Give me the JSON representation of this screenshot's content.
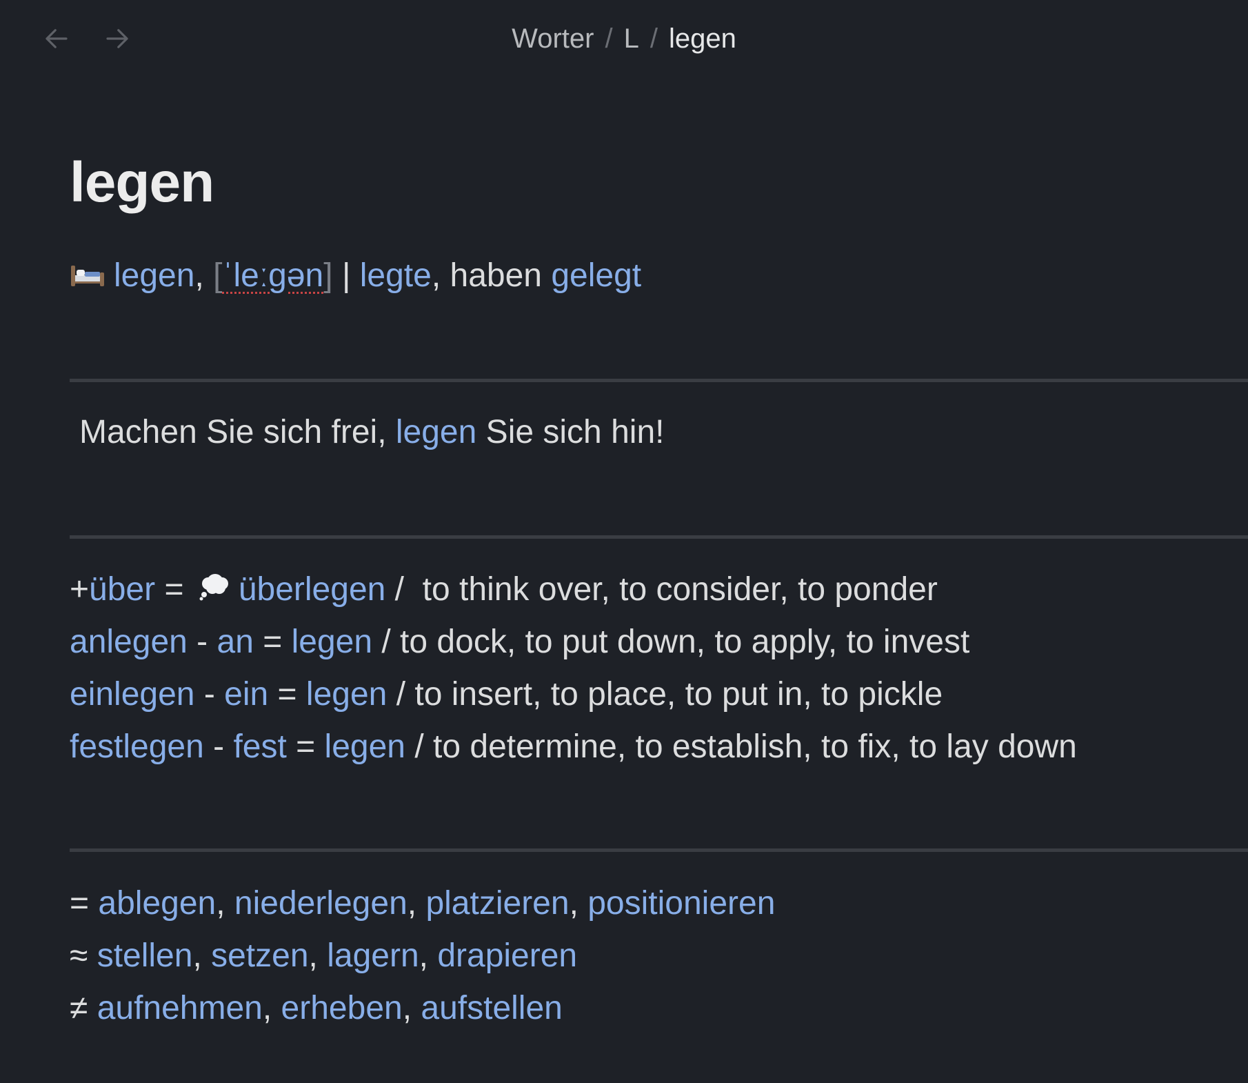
{
  "nav": {
    "back_icon": "arrow-left-icon",
    "forward_icon": "arrow-right-icon"
  },
  "breadcrumb": {
    "items": [
      "Worter",
      "L",
      "legen"
    ],
    "separator": "/"
  },
  "page": {
    "title": "legen"
  },
  "header_line": {
    "icon": "bed-icon",
    "word": "legen",
    "comma1": ",",
    "ipa_open": "[",
    "ipa": "ˈleːɡən",
    "ipa_close": "]",
    "pipe": "|",
    "preterite": "legte",
    "mid_text": ", haben",
    "participle": "gelegt"
  },
  "example": {
    "before": "Machen Sie sich frei,",
    "link": "legen",
    "after": "Sie sich hin!"
  },
  "compounds": [
    {
      "parts": [
        {
          "t": "+",
          "link": false
        },
        {
          "t": "über",
          "link": true
        },
        {
          "t": " = ",
          "link": false
        },
        {
          "icon": "thought-bubble-icon"
        },
        {
          "t": "überlegen",
          "link": true
        },
        {
          "t": " /  to think over, to consider, to ponder",
          "link": false
        }
      ]
    },
    {
      "parts": [
        {
          "t": "anlegen",
          "link": true
        },
        {
          "t": " - ",
          "link": false
        },
        {
          "t": "an",
          "link": true
        },
        {
          "t": " = ",
          "link": false
        },
        {
          "t": "legen",
          "link": true
        },
        {
          "t": " / to dock, to put down, to apply, to invest",
          "link": false
        }
      ]
    },
    {
      "parts": [
        {
          "t": "einlegen",
          "link": true
        },
        {
          "t": " - ",
          "link": false
        },
        {
          "t": "ein",
          "link": true
        },
        {
          "t": " = ",
          "link": false
        },
        {
          "t": "legen",
          "link": true
        },
        {
          "t": " / to insert, to place, to put in, to pickle",
          "link": false
        }
      ]
    },
    {
      "parts": [
        {
          "t": "festlegen",
          "link": true
        },
        {
          "t": " - ",
          "link": false
        },
        {
          "t": "fest",
          "link": true
        },
        {
          "t": " = ",
          "link": false
        },
        {
          "t": "legen",
          "link": true
        },
        {
          "t": " / to determine, to establish, to fix, to lay down",
          "link": false
        }
      ]
    }
  ],
  "relations": [
    {
      "symbol": "=",
      "words": [
        "ablegen",
        "niederlegen",
        "platzieren",
        "positionieren"
      ]
    },
    {
      "symbol": "≈",
      "words": [
        "stellen",
        "setzen",
        "lagern",
        "drapieren"
      ]
    },
    {
      "symbol": "≠",
      "words": [
        "aufnehmen",
        "erheben",
        "aufstellen"
      ]
    }
  ],
  "colors": {
    "background": "#1e2127",
    "link": "#88aee8",
    "text": "#dcddde",
    "rule": "#3a3d43"
  }
}
